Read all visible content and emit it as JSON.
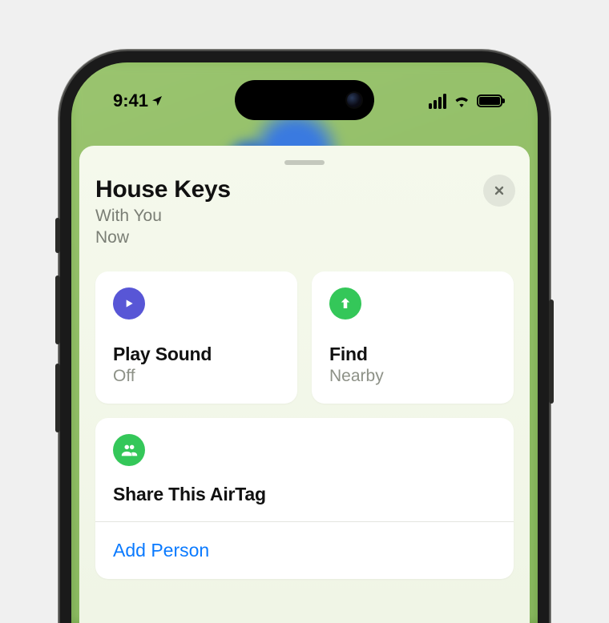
{
  "status": {
    "time": "9:41",
    "location_arrow": "➤"
  },
  "item": {
    "name": "House Keys",
    "location": "With You",
    "timestamp": "Now"
  },
  "actions": {
    "play_sound": {
      "label": "Play Sound",
      "status": "Off"
    },
    "find": {
      "label": "Find",
      "status": "Nearby"
    }
  },
  "share": {
    "title": "Share This AirTag",
    "add_label": "Add Person"
  },
  "colors": {
    "accent_purple": "#5856d6",
    "accent_green": "#34c759",
    "link_blue": "#0a7aff"
  }
}
